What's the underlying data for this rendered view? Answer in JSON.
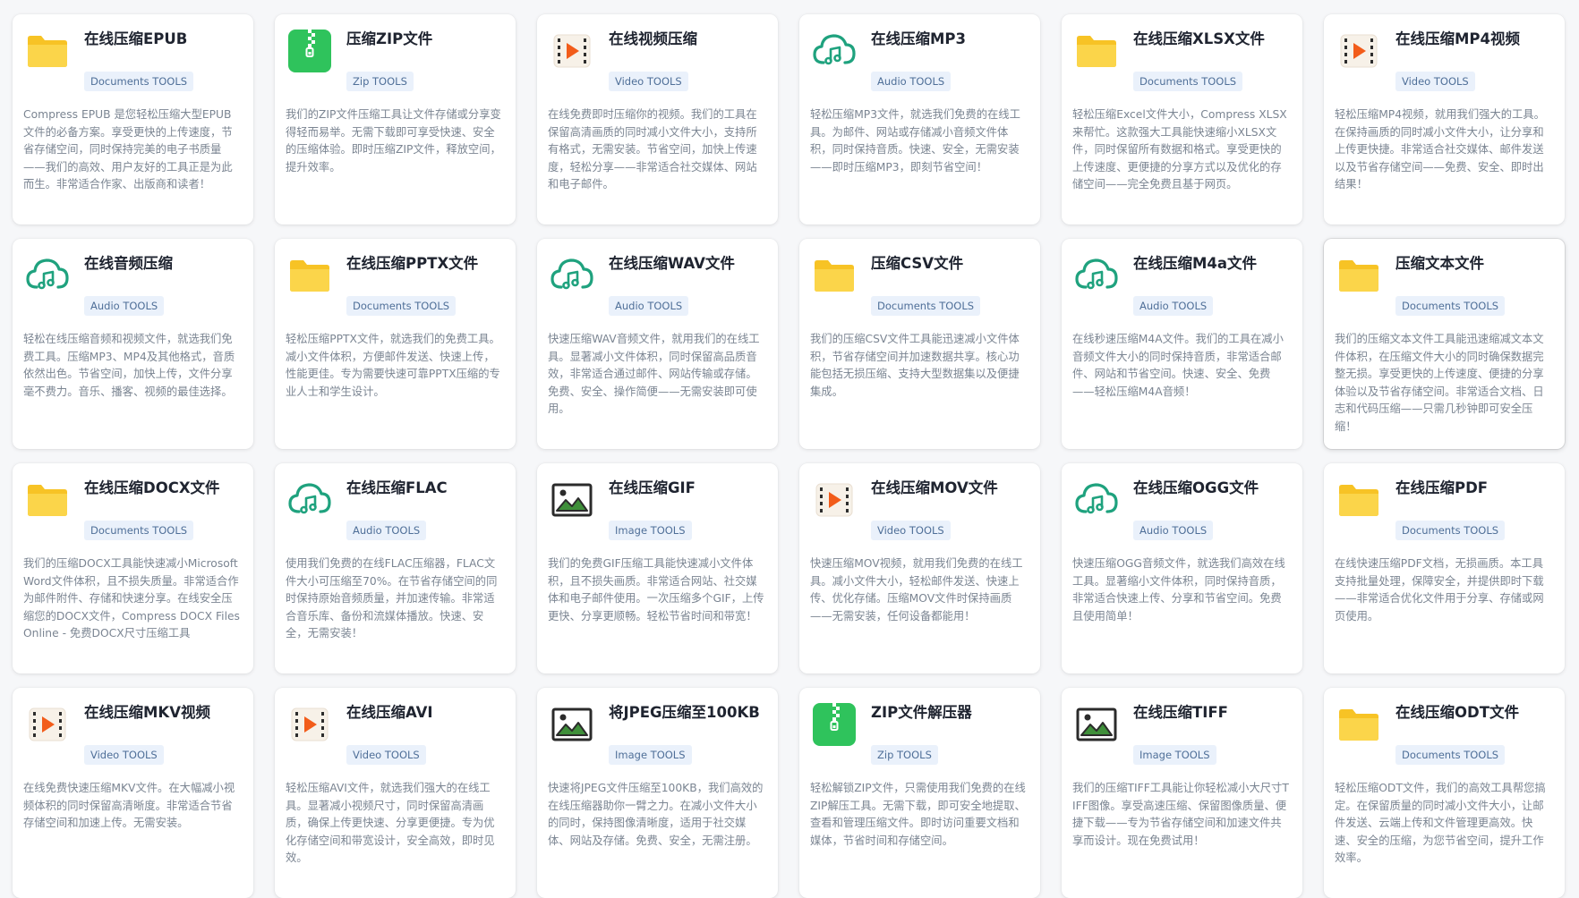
{
  "cards": [
    {
      "title": "在线压缩EPUB",
      "tag": "Documents TOOLS",
      "icon": "folder-icon",
      "desc": "Compress EPUB 是您轻松压缩大型EPUB 文件的必备方案。享受更快的上传速度，节省存储空间，同时保持完美的电子书质量——我们的高效、用户友好的工具正是为此而生。非常适合作家、出版商和读者！"
    },
    {
      "title": "压缩ZIP文件",
      "tag": "Zip TOOLS",
      "icon": "zip-icon",
      "desc": "我们的ZIP文件压缩工具让文件存储或分享变得轻而易举。无需下载即可享受快速、安全的压缩体验。即时压缩ZIP文件，释放空间，提升效率。"
    },
    {
      "title": "在线视频压缩",
      "tag": "Video TOOLS",
      "icon": "video-icon",
      "desc": "在线免费即时压缩你的视频。我们的工具在保留高清画质的同时减小文件大小，支持所有格式，无需安装。节省空间，加快上传速度，轻松分享——非常适合社交媒体、网站和电子邮件。"
    },
    {
      "title": "在线压缩MP3",
      "tag": "Audio TOOLS",
      "icon": "audio-icon",
      "desc": "轻松压缩MP3文件，就选我们免费的在线工具。为邮件、网站或存储减小音频文件体积，同时保持音质。快速、安全，无需安装——即时压缩MP3，即刻节省空间！"
    },
    {
      "title": "在线压缩XLSX文件",
      "tag": "Documents TOOLS",
      "icon": "folder-icon",
      "desc": "轻松压缩Excel文件大小，Compress XLSX来帮忙。这款强大工具能快速缩小XLSX文件，同时保留所有数据和格式。享受更快的上传速度、更便捷的分享方式以及优化的存储空间——完全免费且基于网页。"
    },
    {
      "title": "在线压缩MP4视频",
      "tag": "Video TOOLS",
      "icon": "video-icon",
      "desc": "轻松压缩MP4视频，就用我们强大的工具。在保持画质的同时减小文件大小，让分享和上传更快捷。非常适合社交媒体、邮件发送以及节省存储空间——免费、安全、即时出结果！"
    },
    {
      "title": "在线音频压缩",
      "tag": "Audio TOOLS",
      "icon": "audio-icon",
      "desc": "轻松在线压缩音频和视频文件，就选我们免费工具。压缩MP3、MP4及其他格式，音质依然出色。节省空间，加快上传，文件分享毫不费力。音乐、播客、视频的最佳选择。"
    },
    {
      "title": "在线压缩PPTX文件",
      "tag": "Documents TOOLS",
      "icon": "folder-icon",
      "desc": "轻松压缩PPTX文件，就选我们的免费工具。减小文件体积，方便邮件发送、快速上传，性能更佳。专为需要快速可靠PPTX压缩的专业人士和学生设计。"
    },
    {
      "title": "在线压缩WAV文件",
      "tag": "Audio TOOLS",
      "icon": "audio-icon",
      "desc": "快速压缩WAV音频文件，就用我们的在线工具。显著减小文件体积，同时保留高品质音效，非常适合通过邮件、网站传输或存储。免费、安全、操作简便——无需安装即可使用。"
    },
    {
      "title": "压缩CSV文件",
      "tag": "Documents TOOLS",
      "icon": "folder-icon",
      "desc": "我们的压缩CSV文件工具能迅速减小文件体积，节省存储空间并加速数据共享。核心功能包括无损压缩、支持大型数据集以及便捷集成。"
    },
    {
      "title": "在线压缩M4a文件",
      "tag": "Audio TOOLS",
      "icon": "audio-icon",
      "desc": "在线秒速压缩M4A文件。我们的工具在减小音频文件大小的同时保持音质，非常适合邮件、网站和节省空间。快速、安全、免费——轻松压缩M4A音频！"
    },
    {
      "title": "压缩文本文件",
      "tag": "Documents TOOLS",
      "icon": "folder-icon",
      "desc": "我们的压缩文本文件工具能迅速缩减文本文件体积，在压缩文件大小的同时确保数据完整无损。享受更快的上传速度、便捷的分享体验以及节省存储空间。非常适合文档、日志和代码压缩——只需几秒钟即可安全压缩！"
    },
    {
      "title": "在线压缩DOCX文件",
      "tag": "Documents TOOLS",
      "icon": "folder-icon",
      "desc": "我们的压缩DOCX工具能快速减小Microsoft Word文件体积，且不损失质量。非常适合作为邮件附件、存储和快速分享。在线安全压缩您的DOCX文件，Compress DOCX Files Online - 免费DOCX尺寸压缩工具"
    },
    {
      "title": "在线压缩FLAC",
      "tag": "Audio TOOLS",
      "icon": "audio-icon",
      "desc": "使用我们免费的在线FLAC压缩器，FLAC文件大小可压缩至70%。在节省存储空间的同时保持原始音频质量，并加速传输。非常适合音乐库、备份和流媒体播放。快速、安全，无需安装！"
    },
    {
      "title": "在线压缩GIF",
      "tag": "Image TOOLS",
      "icon": "image-icon",
      "desc": "我们的免费GIF压缩工具能快速减小文件体积，且不损失画质。非常适合网站、社交媒体和电子邮件使用。一次压缩多个GIF，上传更快、分享更顺畅。轻松节省时间和带宽！"
    },
    {
      "title": "在线压缩MOV文件",
      "tag": "Video TOOLS",
      "icon": "video-icon",
      "desc": "快速压缩MOV视频，就用我们免费的在线工具。减小文件大小，轻松邮件发送、快速上传、优化存储。压缩MOV文件时保持画质——无需安装，任何设备都能用！"
    },
    {
      "title": "在线压缩OGG文件",
      "tag": "Audio TOOLS",
      "icon": "audio-icon",
      "desc": "快速压缩OGG音频文件，就选我们高效在线工具。显著缩小文件体积，同时保持音质，非常适合快速上传、分享和节省空间。免费且使用简单！"
    },
    {
      "title": "在线压缩PDF",
      "tag": "Documents TOOLS",
      "icon": "folder-icon",
      "desc": "在线快速压缩PDF文档，无损画质。本工具支持批量处理，保障安全，并提供即时下载——非常适合优化文件用于分享、存储或网页使用。"
    },
    {
      "title": "在线压缩MKV视频",
      "tag": "Video TOOLS",
      "icon": "video-icon",
      "desc": "在线免费快速压缩MKV文件。在大幅减小视频体积的同时保留高清晰度。非常适合节省存储空间和加速上传。无需安装。"
    },
    {
      "title": "在线压缩AVI",
      "tag": "Video TOOLS",
      "icon": "video-icon",
      "desc": "轻松压缩AVI文件，就选我们强大的在线工具。显著减小视频尺寸，同时保留高清画质，确保上传更快速、分享更便捷。专为优化存储空间和带宽设计，安全高效，即时见效。"
    },
    {
      "title": "将JPEG压缩至100KB",
      "tag": "Image TOOLS",
      "icon": "image-icon",
      "desc": "快速将JPEG文件压缩至100KB，我们高效的在线压缩器助你一臂之力。在减小文件大小的同时，保持图像清晰度，适用于社交媒体、网站及存储。免费、安全，无需注册。"
    },
    {
      "title": "ZIP文件解压器",
      "tag": "Zip TOOLS",
      "icon": "zip-icon",
      "desc": "轻松解锁ZIP文件，只需使用我们免费的在线ZIP解压工具。无需下载，即可安全地提取、查看和管理压缩文件。即时访问重要文档和媒体，节省时间和存储空间。"
    },
    {
      "title": "在线压缩TIFF",
      "tag": "Image TOOLS",
      "icon": "image-icon",
      "desc": "我们的压缩TIFF工具能让你轻松减小大尺寸TIFF图像。享受高速压缩、保留图像质量、便捷下载——专为节省存储空间和加速文件共享而设计。现在免费试用！"
    },
    {
      "title": "在线压缩ODT文件",
      "tag": "Documents TOOLS",
      "icon": "folder-icon",
      "desc": "轻松压缩ODT文件，我们的高效工具帮您搞定。在保留质量的同时减小文件大小，让邮件发送、云端上传和文件管理更高效。快速、安全的压缩，为您节省空间，提升工作效率。"
    }
  ]
}
